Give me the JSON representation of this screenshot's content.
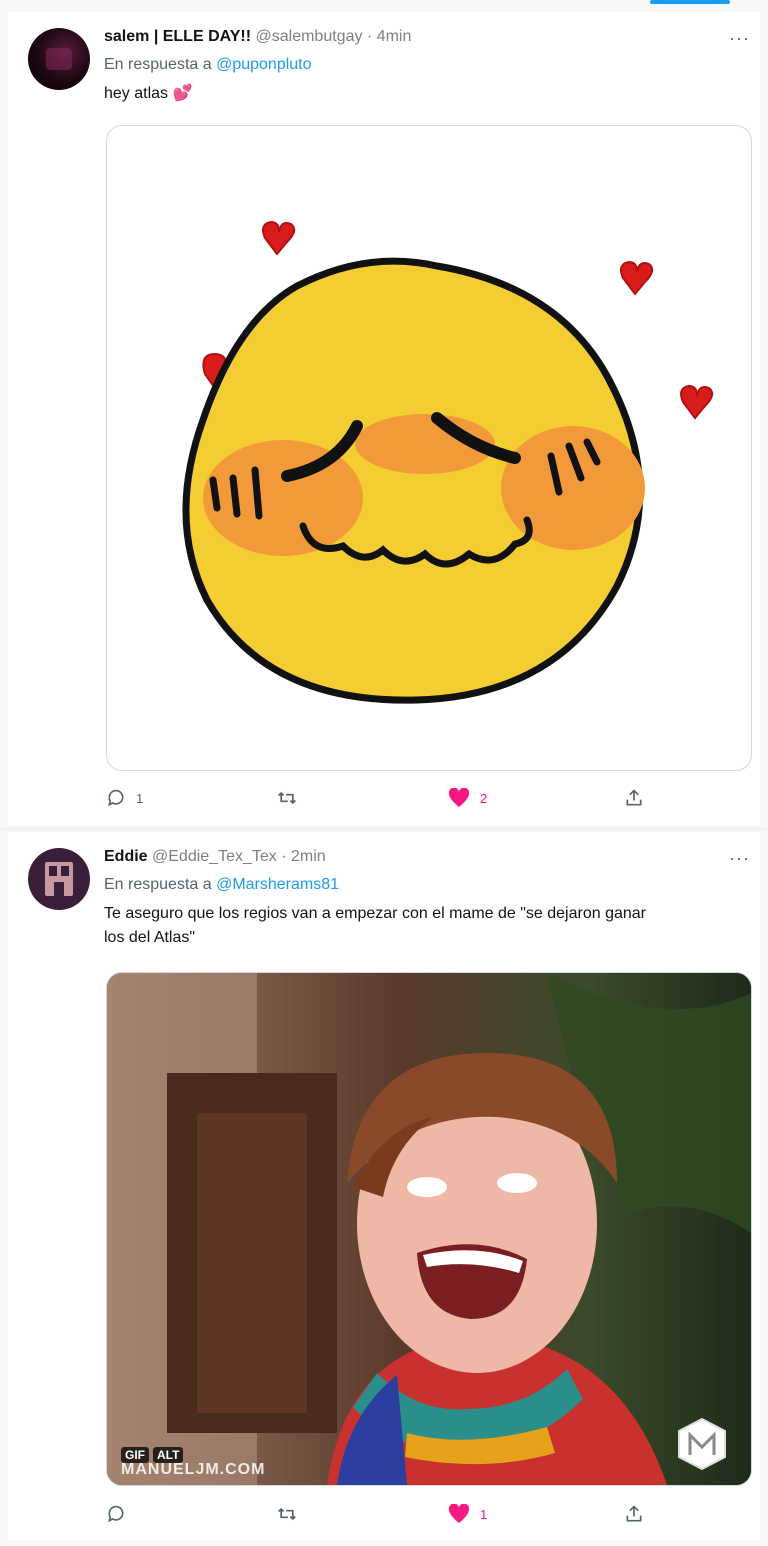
{
  "tweets": [
    {
      "display_name": "salem | ELLE DAY!!",
      "handle": "@salembutgay",
      "time": "4min",
      "reply_prefix": "En respuesta a",
      "reply_to": "@puponpluto",
      "text": "hey atlas 💕",
      "actions": {
        "replies": "1",
        "retweets": "",
        "likes": "2"
      }
    },
    {
      "display_name": "Eddie",
      "handle": "@Eddie_Tex_Tex",
      "time": "2min",
      "reply_prefix": "En respuesta a",
      "reply_to": "@Marsherams81",
      "text_line1": "Te aseguro que los regios van a empezar con el mame de \"se dejaron ganar",
      "text_line2": "los del Atlas\"",
      "media_badges": {
        "gif": "GIF",
        "alt": "ALT"
      },
      "watermark": "MANUELJM.COM",
      "actions": {
        "replies": "",
        "retweets": "",
        "likes": "1"
      }
    }
  ],
  "separator": "·",
  "more_icon": "···",
  "colors": {
    "accent": "#1d9bf0",
    "like": "#f91880",
    "muted": "#536471"
  }
}
